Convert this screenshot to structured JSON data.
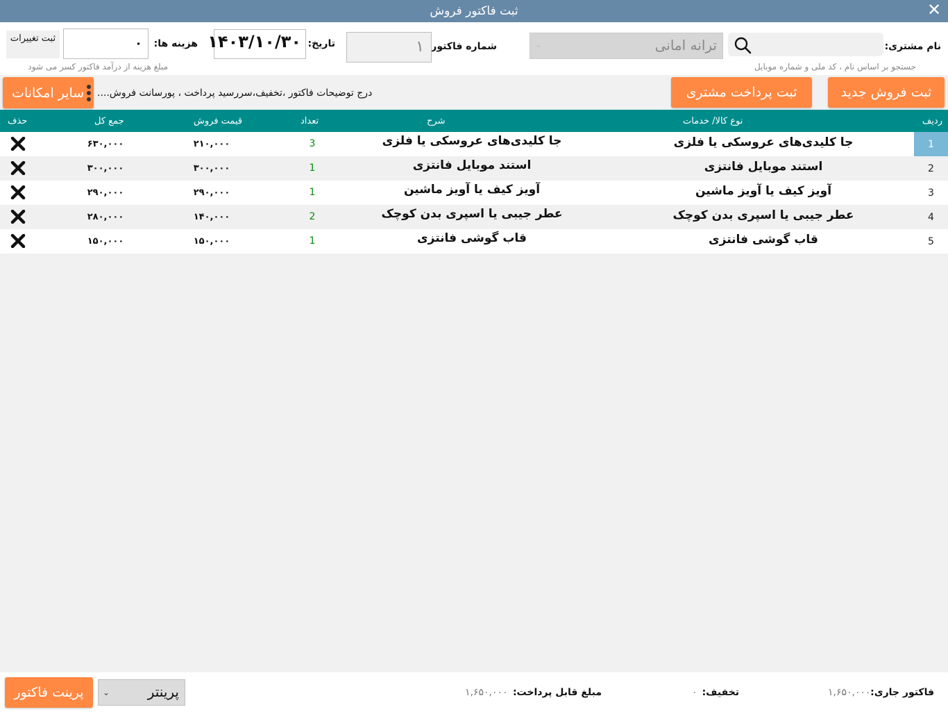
{
  "window": {
    "title": "ثبت فاکتور فروش",
    "close": "✕"
  },
  "customer": {
    "label": "نام مشتری:",
    "search_hint": "جستجو بر اساس نام ، کد ملی و شماره موبایل",
    "selected": "ترانه امانی"
  },
  "invoice": {
    "number_label": "شماره فاکتور:",
    "number": "۱"
  },
  "date": {
    "label": "تاریخ:",
    "value": "۱۴۰۳/۱۰/۳۰"
  },
  "costs": {
    "label": "هزینه ها:",
    "value": "۰",
    "hint": "مبلغ هزینه از درآمد فاکتور کسر می شود",
    "save_label": "ثبت تغییرات"
  },
  "actions": {
    "new_sale": "ثبت فروش جدید",
    "customer_payment": "ثبت پرداخت مشتری",
    "more_options": "سایر امکانات",
    "options_hint": "درج توضیحات فاکتور ،تخفیف،سررسید پرداخت ، پورسانت فروش...."
  },
  "table": {
    "columns": {
      "index": "ردیف",
      "type": "نوع کالا/ خدمات",
      "desc": "شرح",
      "qty": "تعداد",
      "price": "قیمت فروش",
      "total": "جمع کل",
      "delete": "حذف"
    },
    "rows": [
      {
        "index": "1",
        "type": "جا کلیدی‌های عروسکی یا فلزی",
        "desc": "جا کلیدی‌های عروسکی یا فلزی",
        "qty": "3",
        "price": "۲۱۰,۰۰۰",
        "total": "۶۳۰,۰۰۰"
      },
      {
        "index": "2",
        "type": "استند موبایل فانتزی",
        "desc": "استند موبایل فانتزی",
        "qty": "1",
        "price": "۳۰۰,۰۰۰",
        "total": "۳۰۰,۰۰۰"
      },
      {
        "index": "3",
        "type": "آویز کیف یا آویز ماشین",
        "desc": "آویز کیف یا آویز ماشین",
        "qty": "1",
        "price": "۲۹۰,۰۰۰",
        "total": "۲۹۰,۰۰۰"
      },
      {
        "index": "4",
        "type": "عطر جیبی یا اسپری بدن کوچک",
        "desc": "عطر جیبی یا اسپری بدن کوچک",
        "qty": "2",
        "price": "۱۴۰,۰۰۰",
        "total": "۲۸۰,۰۰۰"
      },
      {
        "index": "5",
        "type": "قاب گوشی فانتزی",
        "desc": "قاب گوشی فانتزی",
        "qty": "1",
        "price": "۱۵۰,۰۰۰",
        "total": "۱۵۰,۰۰۰"
      }
    ]
  },
  "footer": {
    "current_label": "فاکتور جاری:",
    "current_value": "۱,۶۵۰,۰۰۰",
    "discount_label": "تخفیف:",
    "discount_value": "۰",
    "payable_label": "مبلغ قابل پرداخت:",
    "payable_value": "۱,۶۵۰,۰۰۰",
    "printer": "پرینتر",
    "print_button": "پرینت فاکتور"
  },
  "colors": {
    "titlebar": "#6789a8",
    "accent": "#ff8843",
    "table_header": "#008b8b",
    "selected_row": "#79b8d6"
  }
}
